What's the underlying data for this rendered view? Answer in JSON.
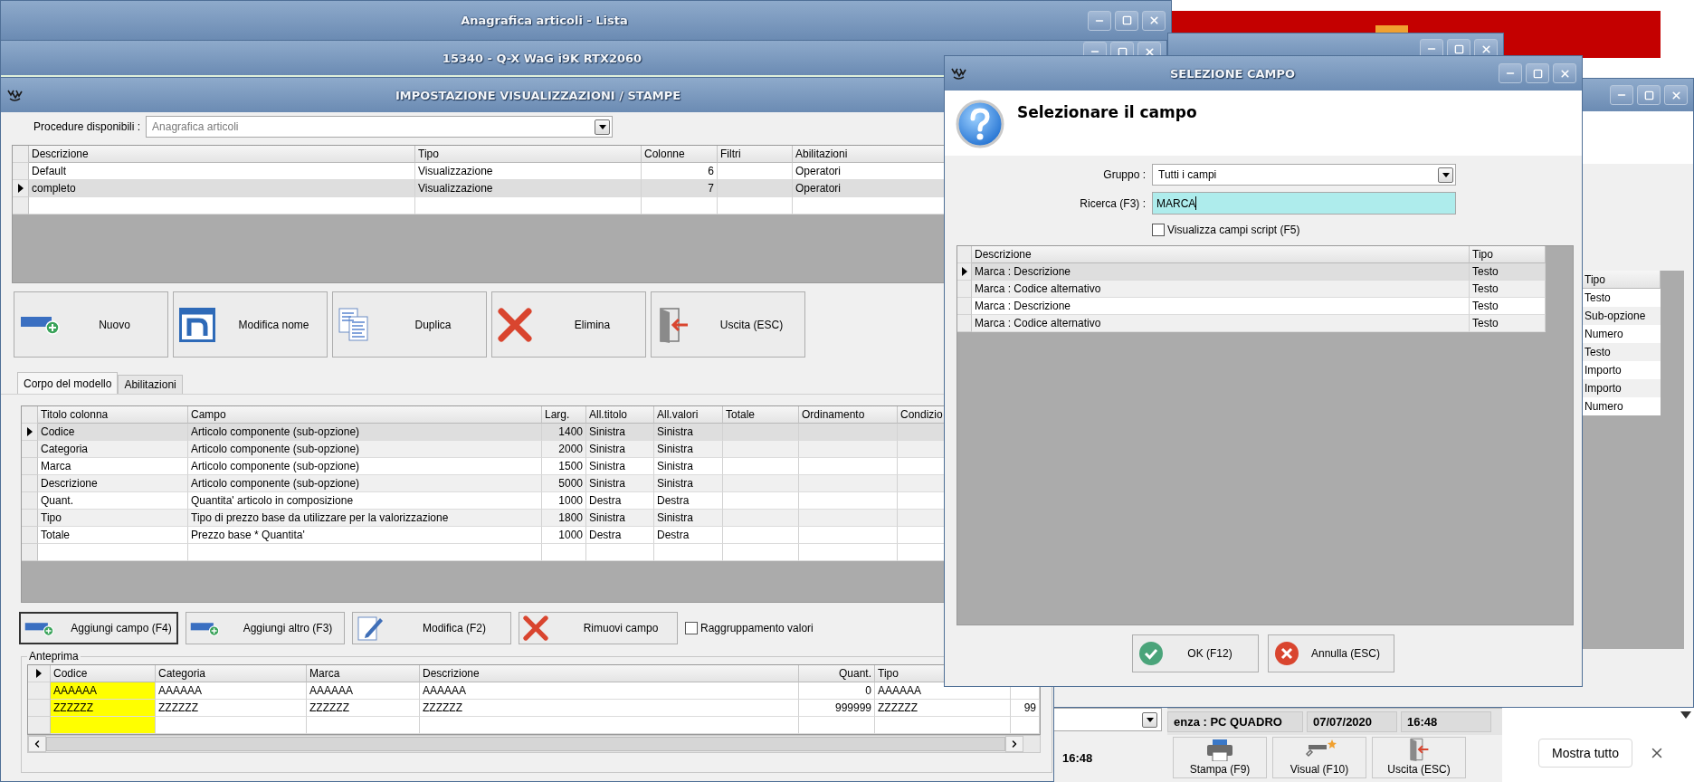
{
  "desktop_windows": [
    {
      "title": "Anagrafica articoli  - Lista"
    },
    {
      "title": "15340 - Q-X WaG i9K RTX2060"
    }
  ],
  "main_window": {
    "title": "IMPOSTAZIONE VISUALIZZAZIONI / STAMPE",
    "procedure": {
      "label": "Procedure disponibili :",
      "value": "Anagrafica articoli",
      "disabled": true
    },
    "models_table": {
      "columns": [
        "Descrizione",
        "Tipo",
        "Colonne",
        "Filtri",
        "Abilitazioni"
      ],
      "rows": [
        {
          "descrizione": "Default",
          "tipo": "Visualizzazione",
          "colonne": "6",
          "abilitazioni": "Operatori",
          "selected": false
        },
        {
          "descrizione": "completo",
          "tipo": "Visualizzazione",
          "colonne": "7",
          "abilitazioni": "Operatori",
          "selected": true
        }
      ]
    },
    "toolbar": [
      {
        "kind": "new",
        "label": "Nuovo"
      },
      {
        "kind": "rename",
        "label": "Modifica nome"
      },
      {
        "kind": "duplicate",
        "label": "Duplica"
      },
      {
        "kind": "delete",
        "label": "Elimina"
      },
      {
        "kind": "exit",
        "label": "Uscita (ESC)"
      }
    ],
    "tabs": [
      {
        "label": "Corpo del modello",
        "selected": true
      },
      {
        "label": "Abilitazioni",
        "selected": false
      }
    ],
    "fields_table": {
      "columns": [
        "Titolo colonna",
        "Campo",
        "Larg.",
        "All.titolo",
        "All.valori",
        "Totale",
        "Ordinamento",
        "Condizio"
      ],
      "rows": [
        {
          "titolo": "Codice",
          "campo": "Articolo componente (sub-opzione)",
          "larg": "1400",
          "all_titolo": "Sinistra",
          "all_valori": "Sinistra",
          "selected": true
        },
        {
          "titolo": "Categoria",
          "campo": "Articolo componente (sub-opzione)",
          "larg": "2000",
          "all_titolo": "Sinistra",
          "all_valori": "Sinistra",
          "selected": false
        },
        {
          "titolo": "Marca",
          "campo": "Articolo componente (sub-opzione)",
          "larg": "1500",
          "all_titolo": "Sinistra",
          "all_valori": "Sinistra",
          "selected": false
        },
        {
          "titolo": "Descrizione",
          "campo": "Articolo componente (sub-opzione)",
          "larg": "5000",
          "all_titolo": "Sinistra",
          "all_valori": "Sinistra",
          "selected": false
        },
        {
          "titolo": "Quant.",
          "campo": "Quantita' articolo in composizione",
          "larg": "1000",
          "all_titolo": "Destra",
          "all_valori": "Destra",
          "selected": false
        },
        {
          "titolo": "Tipo",
          "campo": "Tipo di prezzo base da utilizzare per la valorizzazione",
          "larg": "1800",
          "all_titolo": "Sinistra",
          "all_valori": "Sinistra",
          "selected": false
        },
        {
          "titolo": "Totale",
          "campo": "Prezzo base * Quantita'",
          "larg": "1000",
          "all_titolo": "Destra",
          "all_valori": "Destra",
          "selected": false
        }
      ]
    },
    "actions": [
      {
        "kind": "add",
        "label": "Aggiungi campo (F4)",
        "focused": true
      },
      {
        "kind": "add",
        "label": "Aggiungi altro (F3)",
        "focused": false
      },
      {
        "kind": "edit",
        "label": "Modifica (F2)",
        "focused": false
      },
      {
        "kind": "remove",
        "label": "Rimuovi campo",
        "focused": false
      }
    ],
    "grouping": {
      "label": "Raggruppamento valori",
      "checked": false
    },
    "preview": {
      "title": "Anteprima",
      "columns": [
        {
          "label": "Codice",
          "selected": true
        },
        {
          "label": "Categoria",
          "selected": false
        },
        {
          "label": "Marca",
          "selected": false
        },
        {
          "label": "Descrizione",
          "selected": false
        },
        {
          "label": "Quant.",
          "selected": false
        },
        {
          "label": "Tipo",
          "selected": false
        }
      ],
      "rows": [
        {
          "cells": [
            "AAAAAA",
            "AAAAAA",
            "AAAAAA",
            "AAAAAA",
            "0",
            "AAAAAA"
          ]
        },
        {
          "cells": [
            "ZZZZZZ",
            "ZZZZZZ",
            "ZZZZZZ",
            "ZZZZZZ",
            "999999",
            "ZZZZZZ"
          ],
          "column_7": "99"
        }
      ]
    }
  },
  "selection_dialog": {
    "title": "SELEZIONE CAMPO",
    "heading": "Selezionare il campo",
    "group": {
      "label": "Gruppo :",
      "value": "Tutti i campi"
    },
    "search": {
      "label": "Ricerca (F3) :",
      "value": "MARCA"
    },
    "show_script": {
      "label": "Visualizza campi script (F5)",
      "checked": false
    },
    "columns": [
      "Descrizione",
      "Tipo"
    ],
    "rows": [
      {
        "descrizione": "Marca : Descrizione",
        "tipo": "Testo",
        "selected": true
      },
      {
        "descrizione": "Marca : Codice alternativo",
        "tipo": "Testo",
        "selected": false
      },
      {
        "descrizione": "Marca : Descrizione",
        "tipo": "Testo",
        "selected": false
      },
      {
        "descrizione": "Marca : Codice alternativo",
        "tipo": "Testo",
        "selected": false
      }
    ],
    "buttons": [
      {
        "kind": "ok",
        "label": "OK (F12)"
      },
      {
        "kind": "cancel",
        "label": "Annulla (ESC)"
      }
    ]
  },
  "side_window": {
    "column": "Tipo",
    "values": [
      "Testo",
      "Sub-opzione",
      "Numero",
      "Testo",
      "Importo",
      "Importo",
      "Numero"
    ]
  },
  "status_bar": {
    "licence": "enza : PC QUADRO",
    "date": "07/07/2020",
    "time": "16:48"
  },
  "bottom_toolbar": [
    {
      "kind": "print",
      "label": "Stampa (F9)"
    },
    {
      "kind": "view",
      "label": "Visual (F10)"
    },
    {
      "kind": "exit",
      "label": "Uscita (ESC)"
    }
  ],
  "corner_clock": "16:48",
  "notification": {
    "button": "Mostra tutto"
  }
}
